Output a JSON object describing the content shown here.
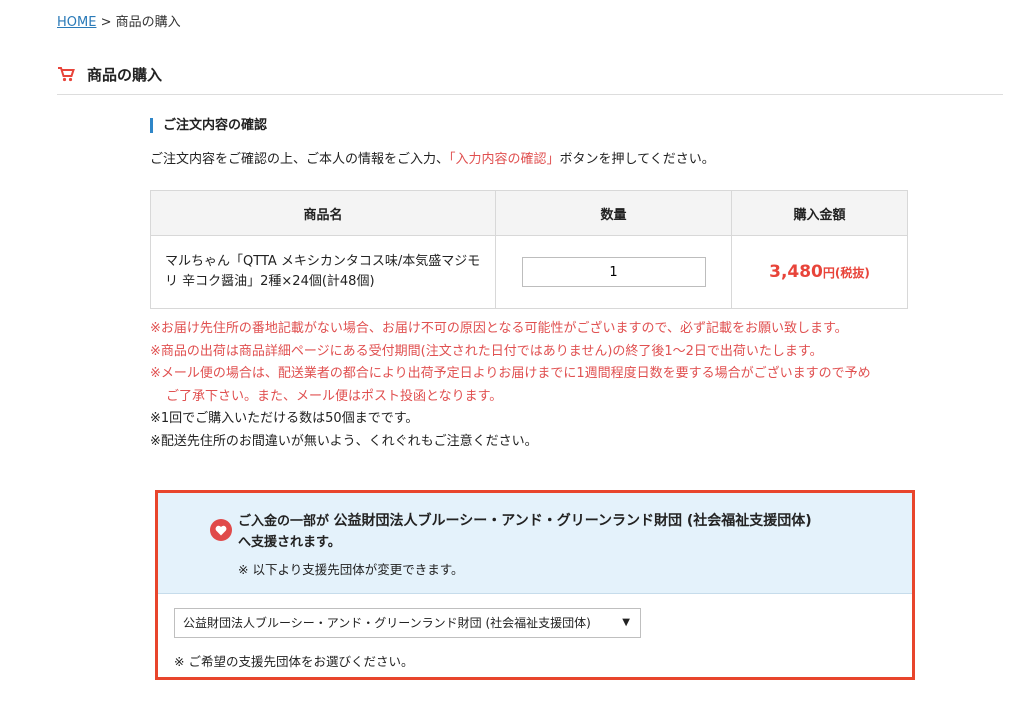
{
  "breadcrumb": {
    "home": "HOME",
    "separator": ">",
    "current": "商品の購入"
  },
  "page": {
    "title": "商品の購入"
  },
  "confirm": {
    "section_title": "ご注文内容の確認",
    "intro_before": "ご注文内容をご確認の上、ご本人の情報をご入力、",
    "intro_highlight": "「入力内容の確認」",
    "intro_after": "ボタンを押してください。"
  },
  "table": {
    "headers": {
      "name": "商品名",
      "qty": "数量",
      "price": "購入金額"
    },
    "row": {
      "name": "マルちゃん「QTTA メキシカンタコス味/本気盛マジモリ 辛コク醤油」2種×24個(計48個)",
      "qty": "1",
      "price_amount": "3,480",
      "price_unit": "円(税抜)"
    }
  },
  "notes": {
    "red1": "※お届け先住所の番地記載がない場合、お届け不可の原因となる可能性がございますので、必ず記載をお願い致します。",
    "red2": "※商品の出荷は商品詳細ページにある受付期間(注文された日付ではありません)の終了後1〜2日で出荷いたします。",
    "red3a": "※メール便の場合は、配送業者の都合により出荷予定日よりお届けまでに1週間程度日数を要する場合がございますので予め",
    "red3b": "ご了承下さい。また、メール便はポスト投函となります。",
    "black1": "※1回でご購入いただける数は50個までです。",
    "black2": "※配送先住所のお間違いが無いよう、くれぐれもご注意ください。"
  },
  "donation": {
    "prefix": "ご入金の一部が ",
    "org": "公益財団法人ブルーシー・アンド・グリーンランド財団 (社会福祉支援団体)",
    "suffix": "へ支援されます。",
    "sub": "※ 以下より支援先団体が変更できます。",
    "select_value": "公益財団法人ブルーシー・アンド・グリーンランド財団 (社会福祉支援団体)",
    "help": "※ ご希望の支援先団体をお選びください。"
  },
  "icons": {
    "cart": "cart-icon",
    "heart": "heart-icon",
    "dropdown": "chevron-down-icon"
  },
  "colors": {
    "accent_red": "#e8443a",
    "note_red": "#e05050",
    "highlight_border": "#e8452c",
    "info_bg": "#e4f2fb",
    "link": "#2a7ab8"
  }
}
